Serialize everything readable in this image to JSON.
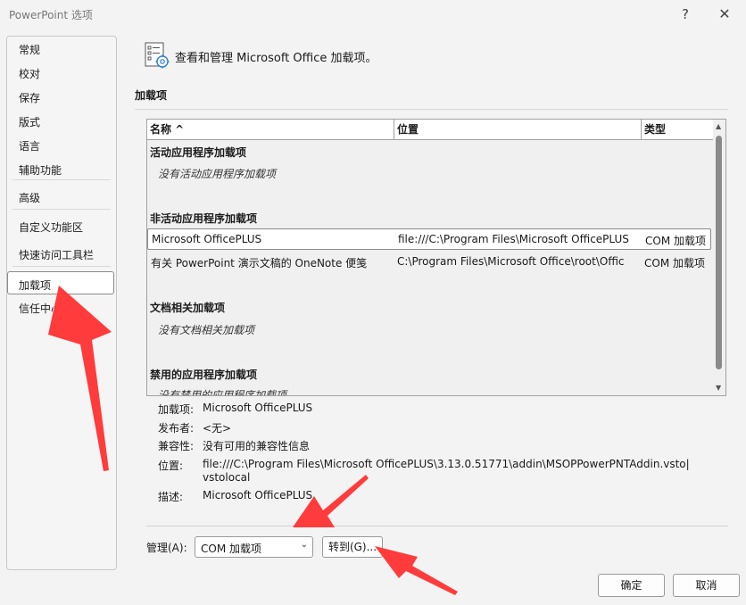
{
  "window": {
    "title": "PowerPoint 选项",
    "help_glyph": "?",
    "close_glyph": "✕"
  },
  "sidebar": {
    "items": [
      {
        "label": "常规"
      },
      {
        "label": "校对"
      },
      {
        "label": "保存"
      },
      {
        "label": "版式"
      },
      {
        "label": "语言"
      },
      {
        "label": "辅助功能"
      },
      {
        "label": "高级"
      },
      {
        "label": "自定义功能区"
      },
      {
        "label": "快速访问工具栏"
      },
      {
        "label": "加载项"
      },
      {
        "label": "信任中心"
      }
    ],
    "selected_index": 9
  },
  "header": {
    "icon": "addins-gear-icon",
    "text": "查看和管理 Microsoft Office 加载项。"
  },
  "section": {
    "title": "加载项"
  },
  "table": {
    "columns": [
      "名称 ^",
      "位置",
      "类型"
    ],
    "groups": [
      {
        "title": "活动应用程序加载项",
        "empty_text": "没有活动应用程序加载项"
      },
      {
        "title": "非活动应用程序加载项"
      },
      {
        "title": "文档相关加载项",
        "empty_text": "没有文档相关加载项"
      },
      {
        "title": "禁用的应用程序加载项",
        "empty_text": "没有禁用的应用程序加载项"
      }
    ],
    "rows": [
      {
        "name": "Microsoft OfficePLUS",
        "location": "file:///C:\\Program Files\\Microsoft OfficePLUS",
        "type": "COM 加载项"
      },
      {
        "name": "有关 PowerPoint 演示文稿的 OneNote 便笺",
        "location": "C:\\Program Files\\Microsoft Office\\root\\Offic",
        "type": "COM 加载项"
      }
    ]
  },
  "details": {
    "addin_label": "加载项:",
    "addin_value": "Microsoft OfficePLUS",
    "publisher_label": "发布者:",
    "publisher_value": "<无>",
    "compat_label": "兼容性:",
    "compat_value": "没有可用的兼容性信息",
    "location_label": "位置:",
    "location_line1": "file:///C:\\Program Files\\Microsoft OfficePLUS\\3.13.0.51771\\addin\\MSOPPowerPNTAddin.vsto|",
    "location_line2": "vstolocal",
    "desc_label": "描述:",
    "desc_value": "Microsoft OfficePLUS"
  },
  "manage": {
    "label": "管理(A):",
    "selected": "COM 加载项",
    "go_button": "转到(G)..."
  },
  "footer": {
    "ok": "确定",
    "cancel": "取消"
  },
  "colors": {
    "annotation_arrow": "#ff3b3b",
    "selection_border": "#8a8a8a"
  }
}
